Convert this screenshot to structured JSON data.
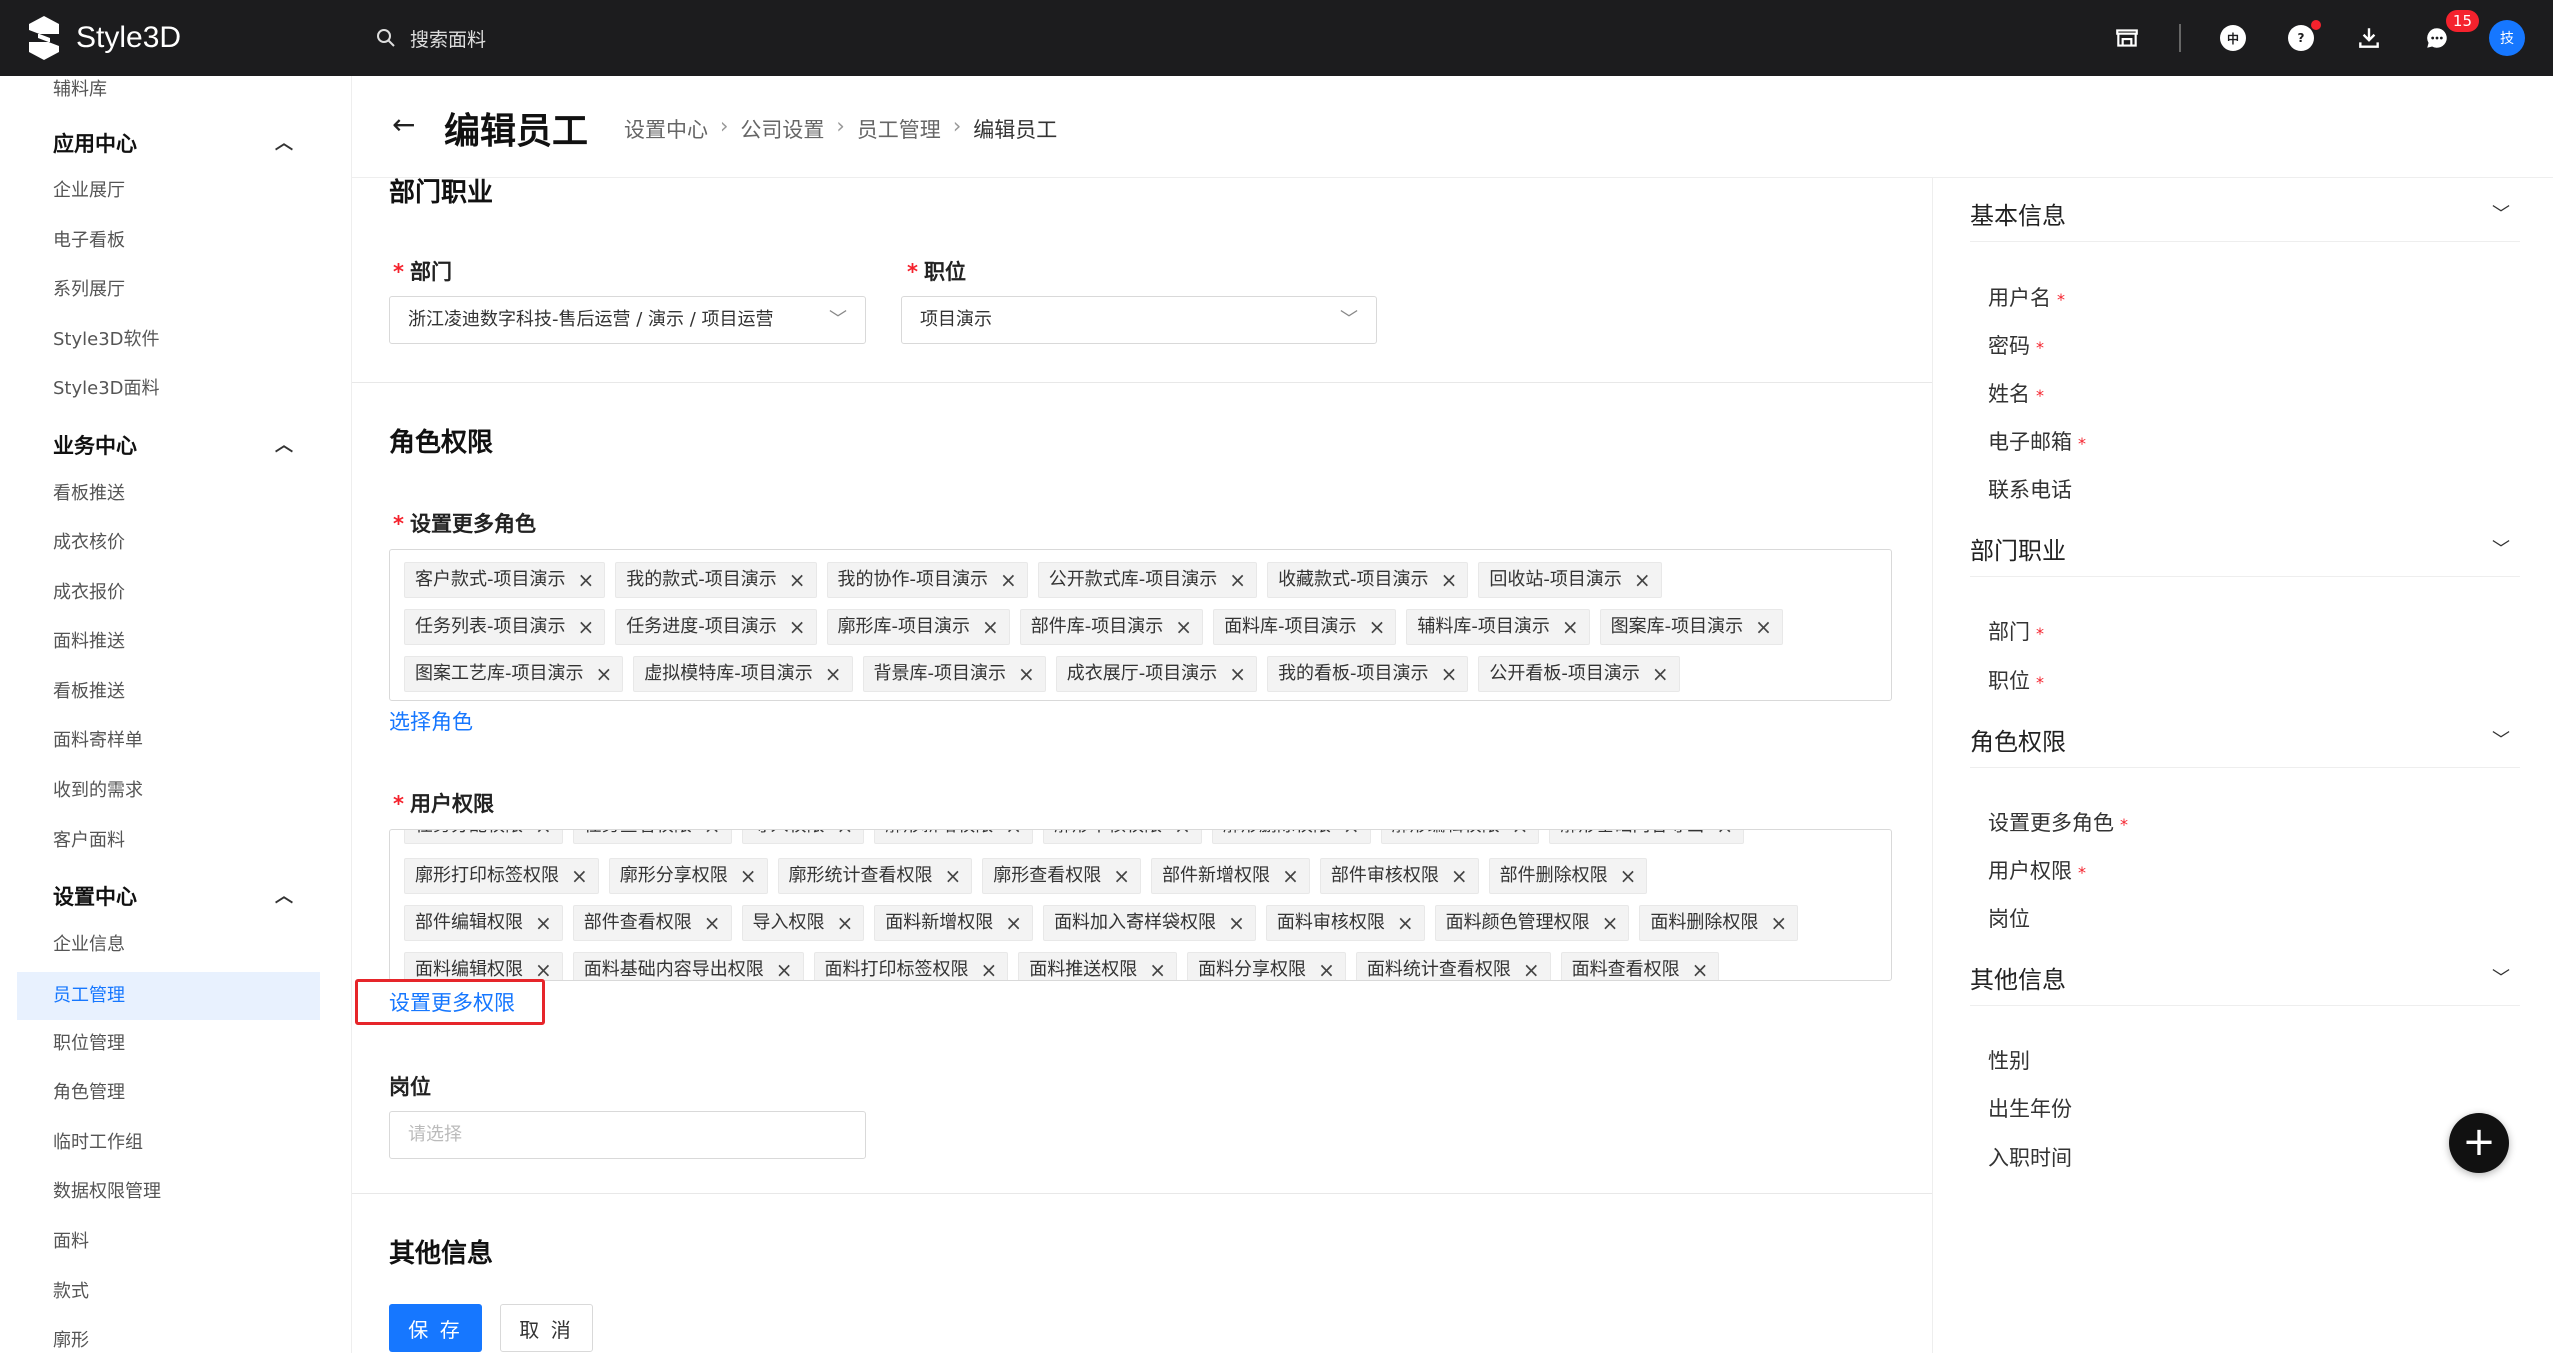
{
  "topbar": {
    "logo_text": "Style3D",
    "search_placeholder": "搜索面料",
    "message_badge": "15",
    "lang_label": "中",
    "avatar_label": "技"
  },
  "sidebar": {
    "top_partial": "辅料库",
    "groups": [
      {
        "title": "应用中心",
        "items": [
          "企业展厅",
          "电子看板",
          "系列展厅",
          "Style3D软件",
          "Style3D面料"
        ]
      },
      {
        "title": "业务中心",
        "items": [
          "看板推送",
          "成衣核价",
          "成衣报价",
          "面料推送",
          "看板推送",
          "面料寄样单",
          "收到的需求",
          "客户面料"
        ]
      },
      {
        "title": "设置中心",
        "items": [
          "企业信息",
          "员工管理",
          "职位管理",
          "角色管理",
          "临时工作组",
          "数据权限管理",
          "面料",
          "款式",
          "廓形"
        ]
      }
    ]
  },
  "header": {
    "title": "编辑员工",
    "breadcrumb": [
      "设置中心",
      "公司设置",
      "员工管理",
      "编辑员工"
    ]
  },
  "form": {
    "section_dept": "部门职业",
    "dept_label": "部门",
    "dept_value": "浙江凌迪数字科技-售后运营 / 演示 / 项目运营",
    "position_label": "职位",
    "position_value": "项目演示",
    "section_roles": "角色权限",
    "roles_label": "设置更多角色",
    "role_rows": [
      [
        "客户款式-项目演示",
        "我的款式-项目演示",
        "我的协作-项目演示",
        "公开款式库-项目演示",
        "收藏款式-项目演示",
        "回收站-项目演示"
      ],
      [
        "任务列表-项目演示",
        "任务进度-项目演示",
        "廓形库-项目演示",
        "部件库-项目演示",
        "面料库-项目演示",
        "辅料库-项目演示",
        "图案库-项目演示"
      ],
      [
        "图案工艺库-项目演示",
        "虚拟模特库-项目演示",
        "背景库-项目演示",
        "成衣展厅-项目演示",
        "我的看板-项目演示",
        "公开看板-项目演示"
      ]
    ],
    "select_role_link": "选择角色",
    "perm_label": "用户权限",
    "perm_rows": [
      [
        "任务分配权限",
        "任务查看权限",
        "导入权限",
        "廓形新增权限",
        "廓形审核权限",
        "廓形删除权限",
        "廓形编辑权限",
        "廓形基础内容导出"
      ],
      [
        "廓形打印标签权限",
        "廓形分享权限",
        "廓形统计查看权限",
        "廓形查看权限",
        "部件新增权限",
        "部件审核权限",
        "部件删除权限"
      ],
      [
        "部件编辑权限",
        "部件查看权限",
        "导入权限",
        "面料新增权限",
        "面料加入寄样袋权限",
        "面料审核权限",
        "面料颜色管理权限",
        "面料删除权限"
      ],
      [
        "面料编辑权限",
        "面料基础内容导出权限",
        "面料打印标签权限",
        "面料推送权限",
        "面料分享权限",
        "面料统计查看权限",
        "面料查看权限"
      ]
    ],
    "more_perm_link": "设置更多权限",
    "post_label": "岗位",
    "post_placeholder": "请选择",
    "section_other": "其他信息",
    "save": "保 存",
    "cancel": "取 消"
  },
  "anchor": {
    "groups": [
      {
        "title": "基本信息",
        "items": [
          {
            "t": "用户名",
            "r": "*"
          },
          {
            "t": "密码",
            "r": "*"
          },
          {
            "t": "姓名",
            "r": "*"
          },
          {
            "t": "电子邮箱",
            "r": "*"
          },
          {
            "t": "联系电话",
            "r": ""
          }
        ]
      },
      {
        "title": "部门职业",
        "items": [
          {
            "t": "部门",
            "r": "*"
          },
          {
            "t": "职位",
            "r": "*"
          }
        ]
      },
      {
        "title": "角色权限",
        "items": [
          {
            "t": "设置更多角色",
            "r": "*"
          },
          {
            "t": "用户权限",
            "r": "*"
          },
          {
            "t": "岗位",
            "r": ""
          }
        ]
      },
      {
        "title": "其他信息",
        "items": [
          {
            "t": "性别",
            "r": ""
          },
          {
            "t": "出生年份",
            "r": ""
          },
          {
            "t": "入职时间",
            "r": ""
          }
        ]
      }
    ]
  },
  "colors": {
    "primary": "#1677ff",
    "topbar": "#1c1c1e",
    "required": "#f5222d",
    "highlight": "#e6252a"
  }
}
